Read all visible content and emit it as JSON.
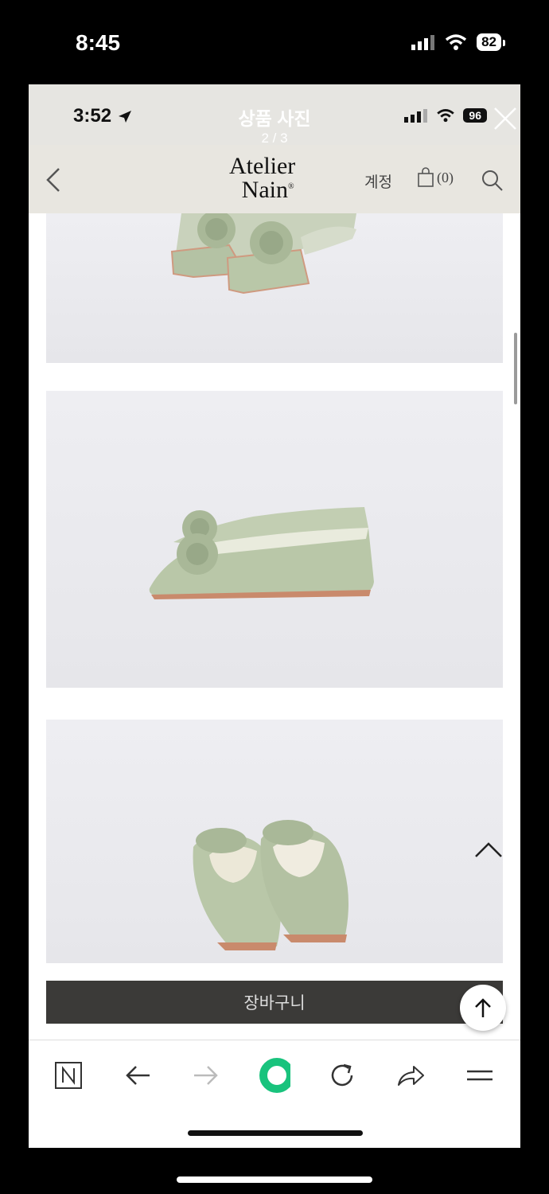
{
  "outer_status": {
    "time": "8:45",
    "battery": "82"
  },
  "inner_status": {
    "time": "3:52",
    "battery": "96"
  },
  "viewer": {
    "title": "상품 사진",
    "count": "2 / 3"
  },
  "header": {
    "logo_line1": "Atelier",
    "logo_line2": "Nain",
    "logo_mark": "®",
    "account_label": "계정",
    "cart_count": "(0)"
  },
  "product": {
    "cart_button_label": "장바구니"
  },
  "icons": {
    "back": "chevron-left-icon",
    "close": "close-icon",
    "bag": "shopping-bag-icon",
    "search": "search-icon",
    "scroll_up": "chevron-up-icon",
    "to_top": "arrow-up-icon",
    "naver": "naver-n-icon",
    "browser_back": "arrow-left-icon",
    "browser_forward": "arrow-right-icon",
    "green_dot": "green-ring-icon",
    "reload": "reload-icon",
    "share": "share-icon",
    "menu": "menu-icon"
  },
  "colors": {
    "header_bg": "#e8e6e0",
    "cart_button_bg": "#3b3a38",
    "shoe_green": "#b9c7a8",
    "accent_green": "#19c37d"
  }
}
